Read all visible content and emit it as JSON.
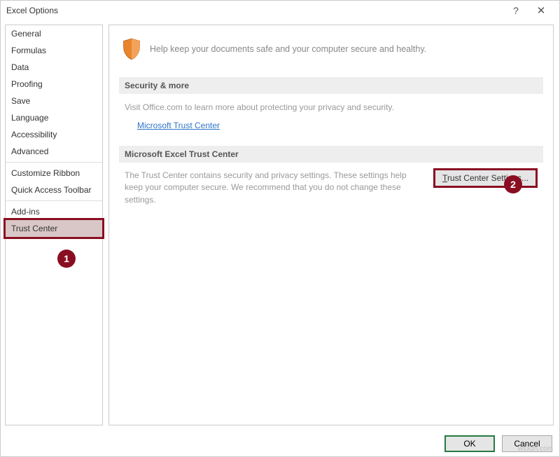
{
  "window": {
    "title": "Excel Options"
  },
  "sidebar": {
    "items": [
      {
        "label": "General"
      },
      {
        "label": "Formulas"
      },
      {
        "label": "Data"
      },
      {
        "label": "Proofing"
      },
      {
        "label": "Save"
      },
      {
        "label": "Language"
      },
      {
        "label": "Accessibility"
      },
      {
        "label": "Advanced"
      },
      {
        "label": "Customize Ribbon"
      },
      {
        "label": "Quick Access Toolbar"
      },
      {
        "label": "Add-ins"
      },
      {
        "label": "Trust Center"
      }
    ]
  },
  "hero": {
    "text": "Help keep your documents safe and your computer secure and healthy."
  },
  "section1": {
    "header": "Security & more",
    "text": "Visit Office.com to learn more about protecting your privacy and security.",
    "link": "Microsoft Trust Center"
  },
  "section2": {
    "header": "Microsoft Excel Trust Center",
    "text": "The Trust Center contains security and privacy settings. These settings help keep your computer secure. We recommend that you do not change these settings.",
    "button_prefix": "T",
    "button_rest": "rust Center Settings..."
  },
  "footer": {
    "ok": "OK",
    "cancel": "Cancel"
  },
  "badges": {
    "one": "1",
    "two": "2"
  },
  "watermark": "wsxdn.com"
}
